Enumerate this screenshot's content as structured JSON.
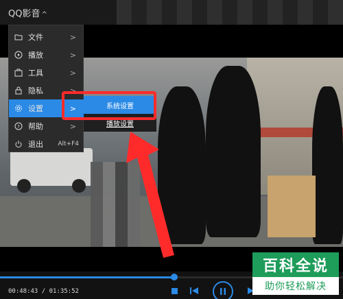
{
  "app": {
    "title": "QQ影音",
    "title_chevron": "^"
  },
  "menu": {
    "items": [
      {
        "label": "文件",
        "icon": "folder-icon",
        "arrow": ">"
      },
      {
        "label": "播放",
        "icon": "play-circle-icon",
        "arrow": ">"
      },
      {
        "label": "工具",
        "icon": "toolbox-icon",
        "arrow": ">"
      },
      {
        "label": "隐私",
        "icon": "lock-icon",
        "arrow": ">"
      },
      {
        "label": "设置",
        "icon": "gear-icon",
        "arrow": ">",
        "active": true
      },
      {
        "label": "帮助",
        "icon": "help-icon",
        "arrow": ">"
      },
      {
        "label": "退出",
        "icon": "power-icon",
        "shortcut": "Alt+F4"
      }
    ]
  },
  "submenu": {
    "items": [
      {
        "label": "系统设置"
      },
      {
        "label": "播放设置"
      }
    ]
  },
  "player": {
    "current_time": "00:48:43",
    "total_time": "01:35:52",
    "time_display": "00:48:43 / 01:35:52",
    "progress_fraction": 0.508
  },
  "watermark": {
    "top": "百科全说",
    "bottom": "助你轻松解决"
  },
  "colors": {
    "accent": "#2b8ae6",
    "highlight": "#ff2b2b",
    "menu_bg": "#2b2b2b",
    "watermark_green": "#1e9c5a"
  }
}
